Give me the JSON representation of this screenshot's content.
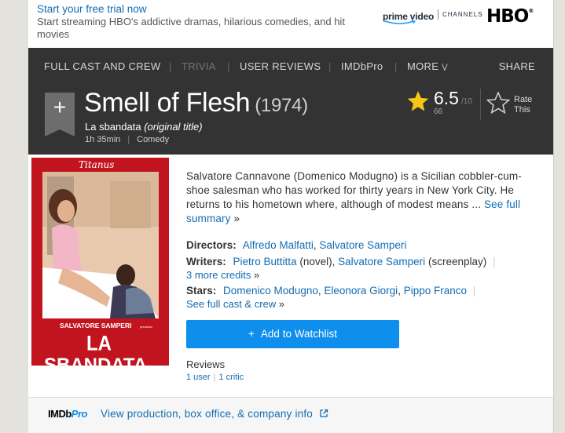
{
  "promo": {
    "link": "Start your free trial now",
    "text": "Start streaming HBO's addictive dramas, hilarious comedies, and hit movies",
    "prime_video": "prime video",
    "channels": "CHANNELS",
    "hbo": "HBO"
  },
  "subnav": {
    "items": [
      "FULL CAST AND CREW",
      "TRIVIA",
      "USER REVIEWS",
      "IMDbPro",
      "MORE"
    ],
    "share": "SHARE"
  },
  "title": {
    "name": "Smell of Flesh",
    "year": "(1974)",
    "original_name": "La sbandata",
    "original_label": "(original title)",
    "runtime": "1h 35min",
    "genre": "Comedy"
  },
  "rating": {
    "value": "6.5",
    "max": "/10",
    "count": "66",
    "rate_label": "Rate This",
    "star_color": "#f5c518"
  },
  "poster": {
    "studio": "Titanus",
    "director_credit": "SALVATORE SAMPERI",
    "presents": "presenta",
    "title_line1": "LA",
    "title_line2": "SBANDATA"
  },
  "summary": {
    "text": "Salvatore Cannavone (Domenico Modugno) is a Sicilian cobbler-cum-shoe salesman who has worked for thirty years in New York City. He returns to his hometown where, although of modest means ...",
    "link": "See full summary",
    "raquo": "»"
  },
  "credits": {
    "directors_label": "Directors:",
    "directors": [
      "Alfredo Malfatti",
      "Salvatore Samperi"
    ],
    "writers_label": "Writers:",
    "writer1": "Pietro Buttitta",
    "writer1_role": "(novel),",
    "writer2": "Salvatore Samperi",
    "writer2_role": "(screenplay)",
    "more_credits": "3 more credits",
    "stars_label": "Stars:",
    "stars": [
      "Domenico Modugno",
      "Eleonora Giorgi",
      "Pippo Franco"
    ],
    "full_cast": "See full cast & crew"
  },
  "watchlist": {
    "label": "Add to Watchlist",
    "color": "#0e8eed"
  },
  "reviews": {
    "heading": "Reviews",
    "user": "1 user",
    "critic": "1 critic"
  },
  "pro": {
    "logo_imdb": "IMDb",
    "logo_pro": "Pro",
    "link": "View production, box office, & company info"
  }
}
